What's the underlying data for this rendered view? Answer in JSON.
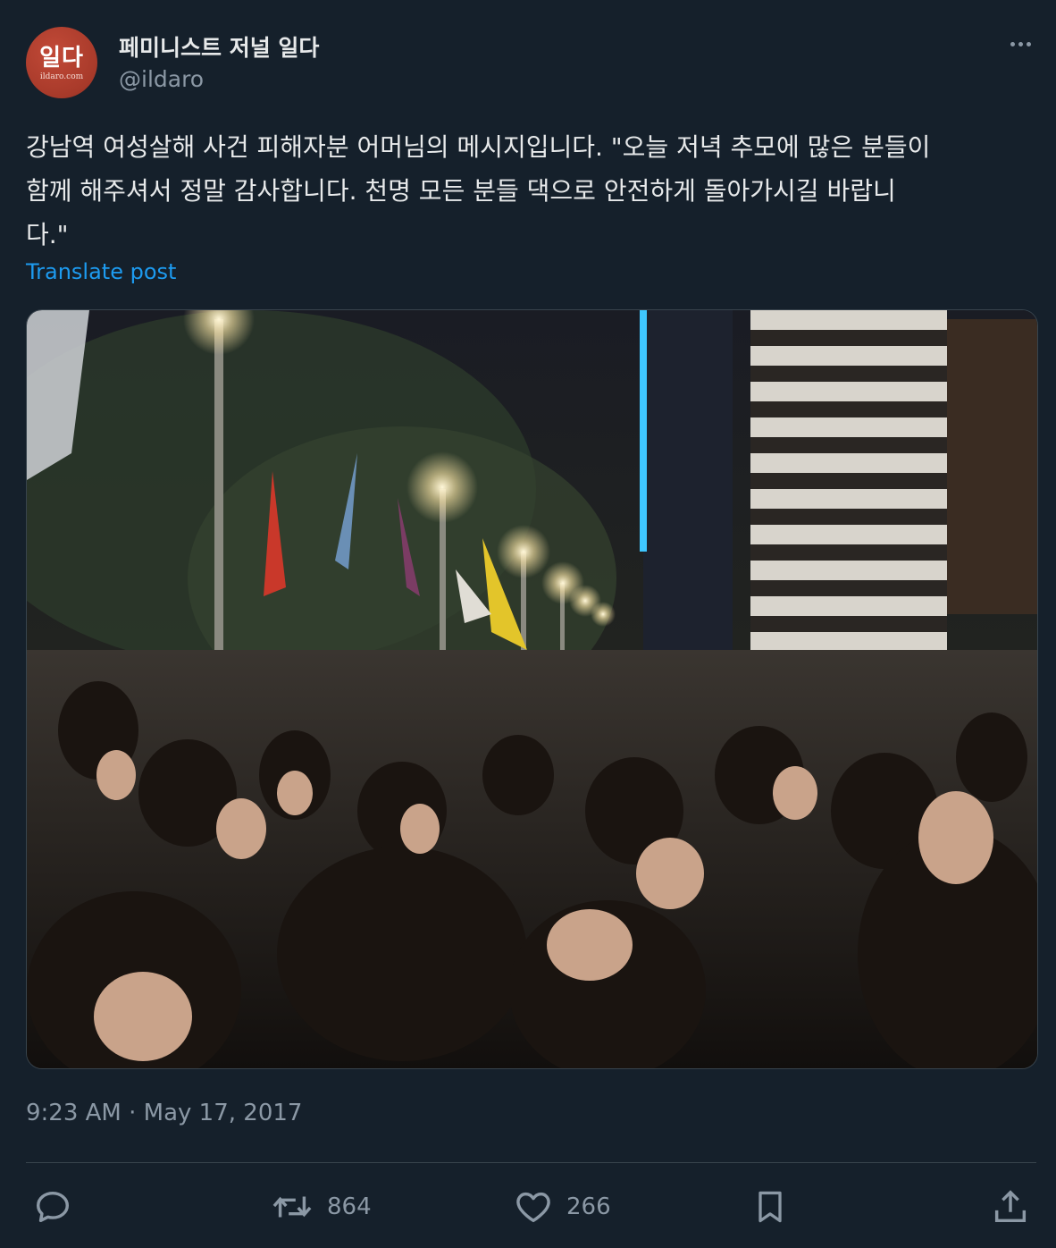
{
  "author": {
    "display_name": "페미니스트 저널 일다",
    "handle": "@ildaro",
    "avatar_text": "일다",
    "avatar_subtext": "ildaro.com"
  },
  "tweet": {
    "text": "강남역 여성살해 사건 피해자분 어머님의 메시지입니다. \"오늘 저녁 추모에 많은 분들이\n함께 해주셔서 정말 감사합니다. 천명 모든 분들 댁으로 안전하게 돌아가시길 바랍니\n다.\"",
    "translate_label": "Translate post",
    "timestamp": "9:23 AM · May 17, 2017"
  },
  "actions": {
    "reply_icon": "speech-bubble-icon",
    "retweet_icon": "retweet-icon",
    "retweet_count": "864",
    "like_icon": "heart-icon",
    "like_count": "266",
    "bookmark_icon": "bookmark-icon",
    "share_icon": "share-icon"
  },
  "colors": {
    "background": "#15202b",
    "text_primary": "#e7e9ea",
    "text_secondary": "#8b98a5",
    "link": "#1d9bf0",
    "border": "#38444d",
    "avatar_bg": "#a83a2a"
  }
}
